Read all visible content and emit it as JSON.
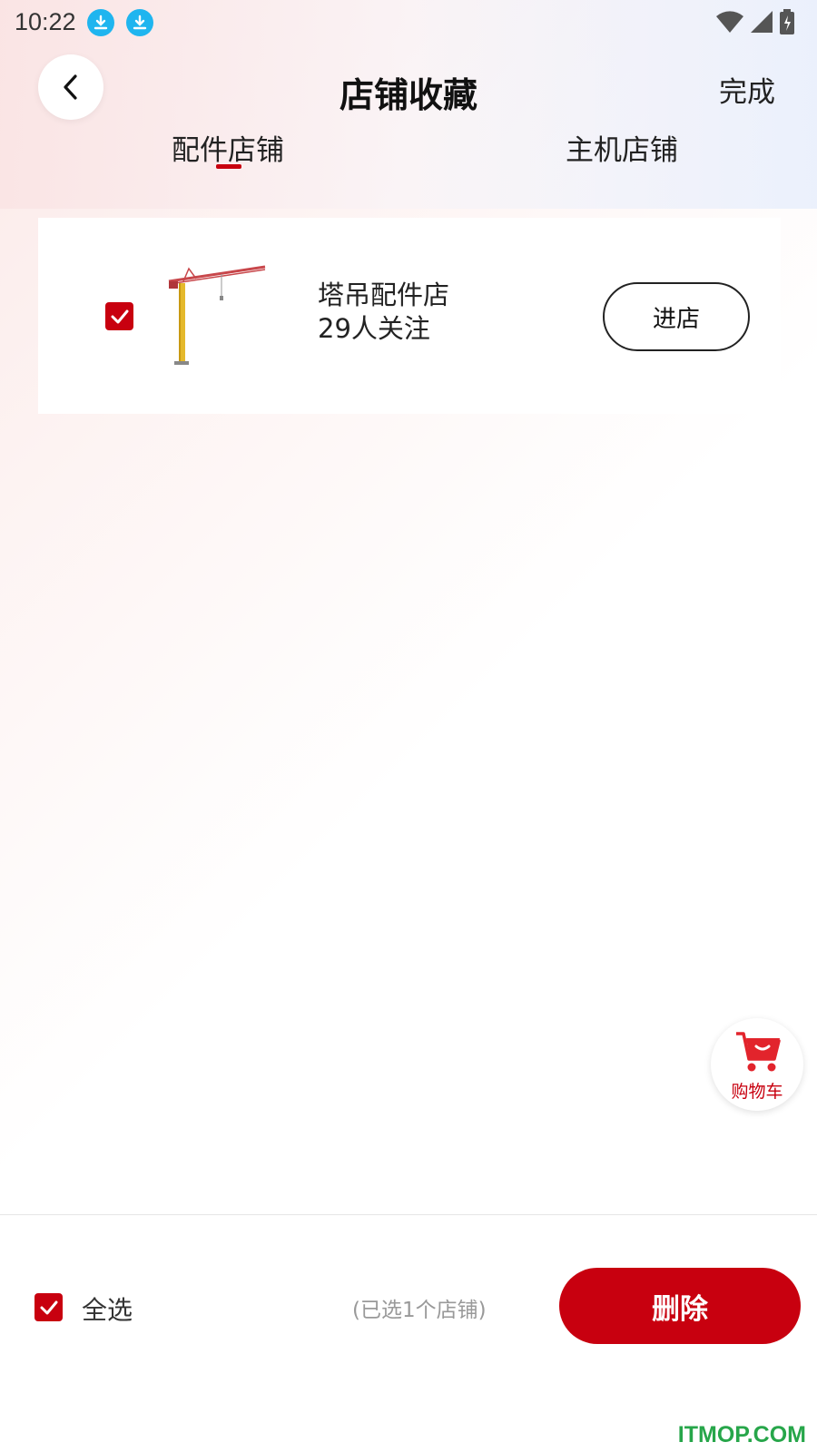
{
  "status_bar": {
    "time": "10:22",
    "icons": [
      "download-icon",
      "download-icon",
      "wifi-icon",
      "signal-icon",
      "battery-icon"
    ]
  },
  "header": {
    "title": "店铺收藏",
    "done_label": "完成"
  },
  "tabs": [
    {
      "label": "配件店铺",
      "active": true
    },
    {
      "label": "主机店铺",
      "active": false
    }
  ],
  "shops": [
    {
      "name": "塔吊配件店",
      "followers": "29人关注",
      "enter_label": "进店",
      "checked": true,
      "image": "tower-crane-image"
    }
  ],
  "cart_fab": {
    "label": "购物车",
    "icon": "shopping-cart-icon"
  },
  "bottom_bar": {
    "select_all_label": "全选",
    "select_all_checked": true,
    "selected_count": "(已选1个店铺)",
    "delete_label": "删除"
  },
  "watermark": "ITMOP.COM",
  "colors": {
    "accent": "#c8000f",
    "download_icon": "#1fb5ef",
    "watermark": "#27a64a"
  }
}
